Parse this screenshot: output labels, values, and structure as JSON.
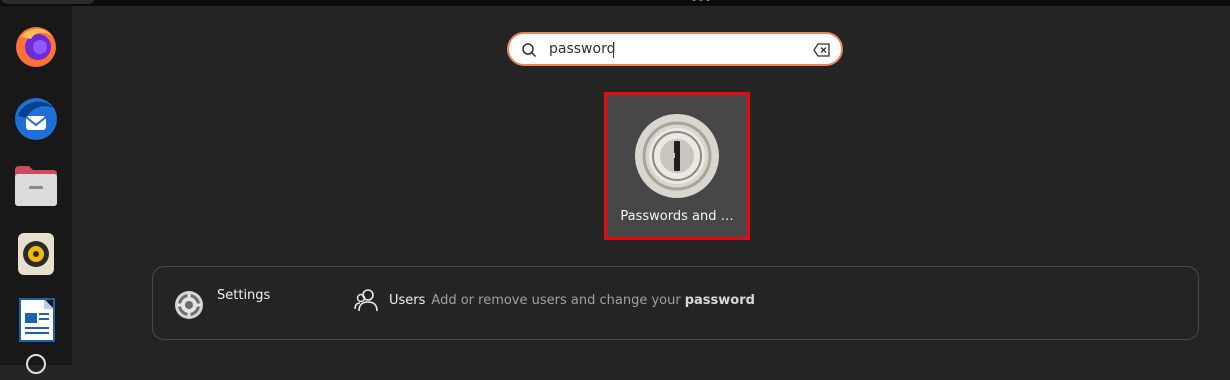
{
  "dock": {
    "items": [
      {
        "name": "Firefox",
        "icon": "firefox-icon"
      },
      {
        "name": "Thunderbird",
        "icon": "thunderbird-icon"
      },
      {
        "name": "Files",
        "icon": "files-icon"
      },
      {
        "name": "Rhythmbox",
        "icon": "rhythmbox-icon"
      },
      {
        "name": "LibreOffice Writer",
        "icon": "writer-icon"
      },
      {
        "name": "Help",
        "icon": "help-icon"
      }
    ]
  },
  "search": {
    "value": "password",
    "icon": "search-icon",
    "clear_icon": "clear-icon",
    "border_color": "#e9855f"
  },
  "app_results": [
    {
      "label": "Passwords and …",
      "icon": "passwords-keys-icon",
      "highlight_color": "#e8090e"
    }
  ],
  "providers": [
    {
      "name": "Settings",
      "icon": "settings-icon",
      "results": [
        {
          "icon": "user-icon",
          "title": "Users",
          "description": "Add or remove users and change your",
          "highlight": "password"
        }
      ]
    }
  ]
}
